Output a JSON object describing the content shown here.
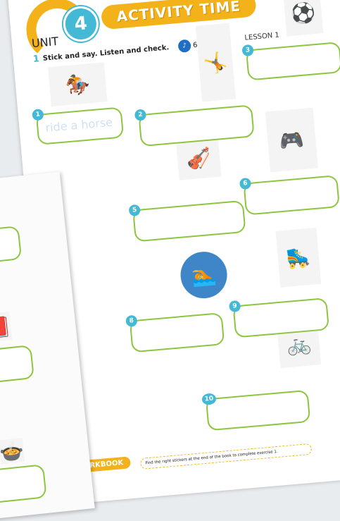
{
  "header": {
    "unit_label": "UNIT",
    "unit_number": "4",
    "title": "ACTIVITY TIME",
    "lesson": "LESSON 1"
  },
  "exercise": {
    "number": "1",
    "instruction": "Stick and say. Listen and check.",
    "audio_track": "6"
  },
  "items": [
    {
      "n": "1",
      "answer": "ride a horse"
    },
    {
      "n": "2",
      "answer": ""
    },
    {
      "n": "3",
      "answer": ""
    },
    {
      "n": "5",
      "answer": ""
    },
    {
      "n": "6",
      "answer": ""
    },
    {
      "n": "8",
      "answer": ""
    },
    {
      "n": "9",
      "answer": ""
    },
    {
      "n": "10",
      "answer": ""
    }
  ],
  "footer": {
    "workbook_label": "RKBOOK",
    "note": "Find the right stickers at the end of the book to complete exercise 1."
  },
  "colors": {
    "accent": "#f3b21a",
    "box_border": "#8cc63f",
    "number_badge": "#43b9d6"
  }
}
